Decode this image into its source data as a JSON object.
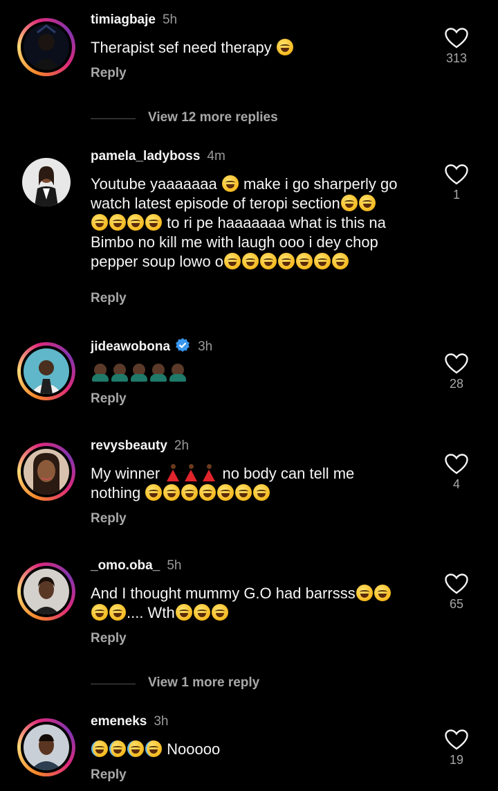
{
  "comments": [
    {
      "username": "timiagbaje",
      "time": "5h",
      "text": "Therapist sef need therapy",
      "likes": "313",
      "reply": "Reply"
    },
    {
      "username": "pamela_ladyboss",
      "time": "4m",
      "text_lines": [
        "Youtube yaaaaaaa",
        "make i go sharperly go",
        "watch latest episode of teropi section",
        "to ri pe haaaaaaa what is this na",
        "Bimbo no kill me with laugh ooo i dey chop",
        "pepper soup lowo o"
      ],
      "likes": "1",
      "reply": "Reply"
    },
    {
      "username": "jideawobona",
      "time": "3h",
      "likes": "28",
      "reply": "Reply"
    },
    {
      "username": "revysbeauty",
      "time": "2h",
      "text_a": "My winner",
      "text_b": "no body can tell me",
      "text_c": "nothing",
      "likes": "4",
      "reply": "Reply"
    },
    {
      "username": "_omo.oba_",
      "time": "5h",
      "text_a": "And I thought mummy G.O had barrsss",
      "text_b": ".... Wth",
      "likes": "65",
      "reply": "Reply"
    },
    {
      "username": "emeneks",
      "time": "3h",
      "text": "Nooooo",
      "likes": "19",
      "reply": "Reply"
    }
  ],
  "view_more": [
    "View 12 more replies",
    "View 1 more reply"
  ],
  "icons": {
    "like": "heart-outline-icon",
    "verified": "verified-badge-icon"
  },
  "colors": {
    "background": "#000000",
    "text": "#f5f5f5",
    "muted": "#a8a8a8",
    "verified": "#3897f0"
  }
}
